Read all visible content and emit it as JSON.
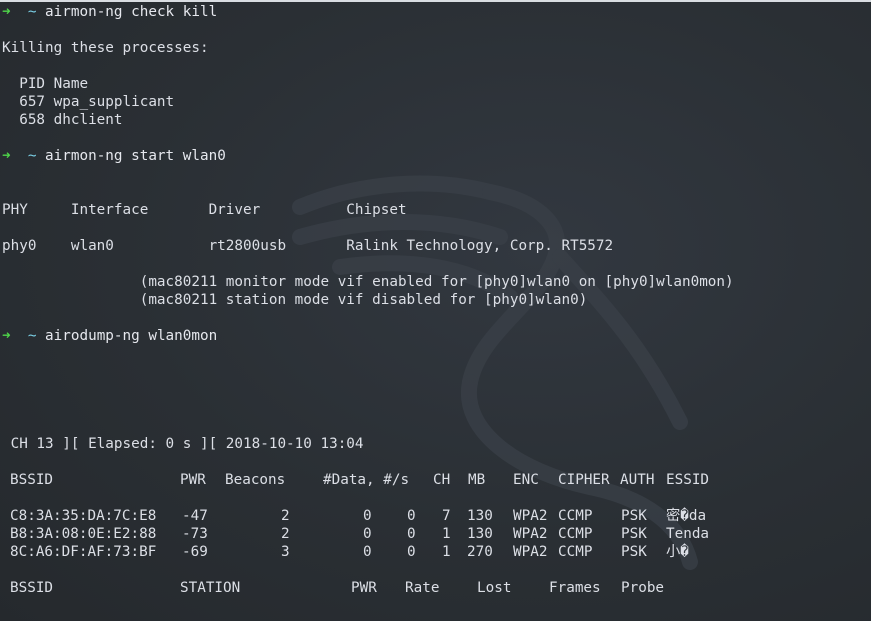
{
  "session": [
    {
      "type": "prompt",
      "arrow": "➜",
      "dir": "~",
      "command": "airmon-ng check kill"
    },
    {
      "type": "blank"
    },
    {
      "type": "text",
      "text": "Killing these processes:"
    },
    {
      "type": "blank"
    },
    {
      "type": "text",
      "text": "  PID Name"
    },
    {
      "type": "text",
      "text": "  657 wpa_supplicant"
    },
    {
      "type": "text",
      "text": "  658 dhclient"
    },
    {
      "type": "blank"
    },
    {
      "type": "prompt",
      "arrow": "➜",
      "dir": "~",
      "command": "airmon-ng start wlan0"
    },
    {
      "type": "blank"
    },
    {
      "type": "blank"
    },
    {
      "type": "text",
      "text": "PHY     Interface       Driver          Chipset"
    },
    {
      "type": "blank"
    },
    {
      "type": "text",
      "text": "phy0    wlan0           rt2800usb       Ralink Technology, Corp. RT5572"
    },
    {
      "type": "blank"
    },
    {
      "type": "text",
      "text": "                (mac80211 monitor mode vif enabled for [phy0]wlan0 on [phy0]wlan0mon)"
    },
    {
      "type": "text",
      "text": "                (mac80211 station mode vif disabled for [phy0]wlan0)"
    },
    {
      "type": "blank"
    },
    {
      "type": "prompt",
      "arrow": "➜",
      "dir": "~",
      "command": "airodump-ng wlan0mon"
    },
    {
      "type": "blank"
    },
    {
      "type": "blank"
    },
    {
      "type": "blank"
    },
    {
      "type": "blank"
    },
    {
      "type": "blank"
    },
    {
      "type": "text",
      "text": " CH 13 ][ Elapsed: 0 s ][ 2018-10-10 13:04"
    },
    {
      "type": "blank"
    },
    {
      "type": "row",
      "cells": [
        "BSSID",
        "PWR",
        "Beacons",
        "#Data, #/s",
        "CH",
        "MB",
        "ENC",
        "CIPHER",
        "AUTH",
        "ESSID"
      ]
    },
    {
      "type": "blank"
    },
    {
      "type": "row",
      "cells": [
        "C8:3A:35:DA:7C:E8",
        "-47",
        "2",
        "0",
        "0",
        "7",
        "130",
        "WPA2",
        "CCMP",
        "PSK",
        "密�da"
      ]
    },
    {
      "type": "row",
      "cells": [
        "B8:3A:08:0E:E2:88",
        "-73",
        "2",
        "0",
        "0",
        "1",
        "130",
        "WPA2",
        "CCMP",
        "PSK",
        "Tenda"
      ]
    },
    {
      "type": "row",
      "cells": [
        "8C:A6:DF:AF:73:BF",
        "-69",
        "3",
        "0",
        "0",
        "1",
        "270",
        "WPA2",
        "CCMP",
        "PSK",
        "小�"
      ]
    },
    {
      "type": "blank"
    },
    {
      "type": "row",
      "cells": [
        "BSSID",
        "STATION",
        "PWR",
        "Rate",
        "Lost",
        "Frames",
        "Probe"
      ]
    }
  ]
}
